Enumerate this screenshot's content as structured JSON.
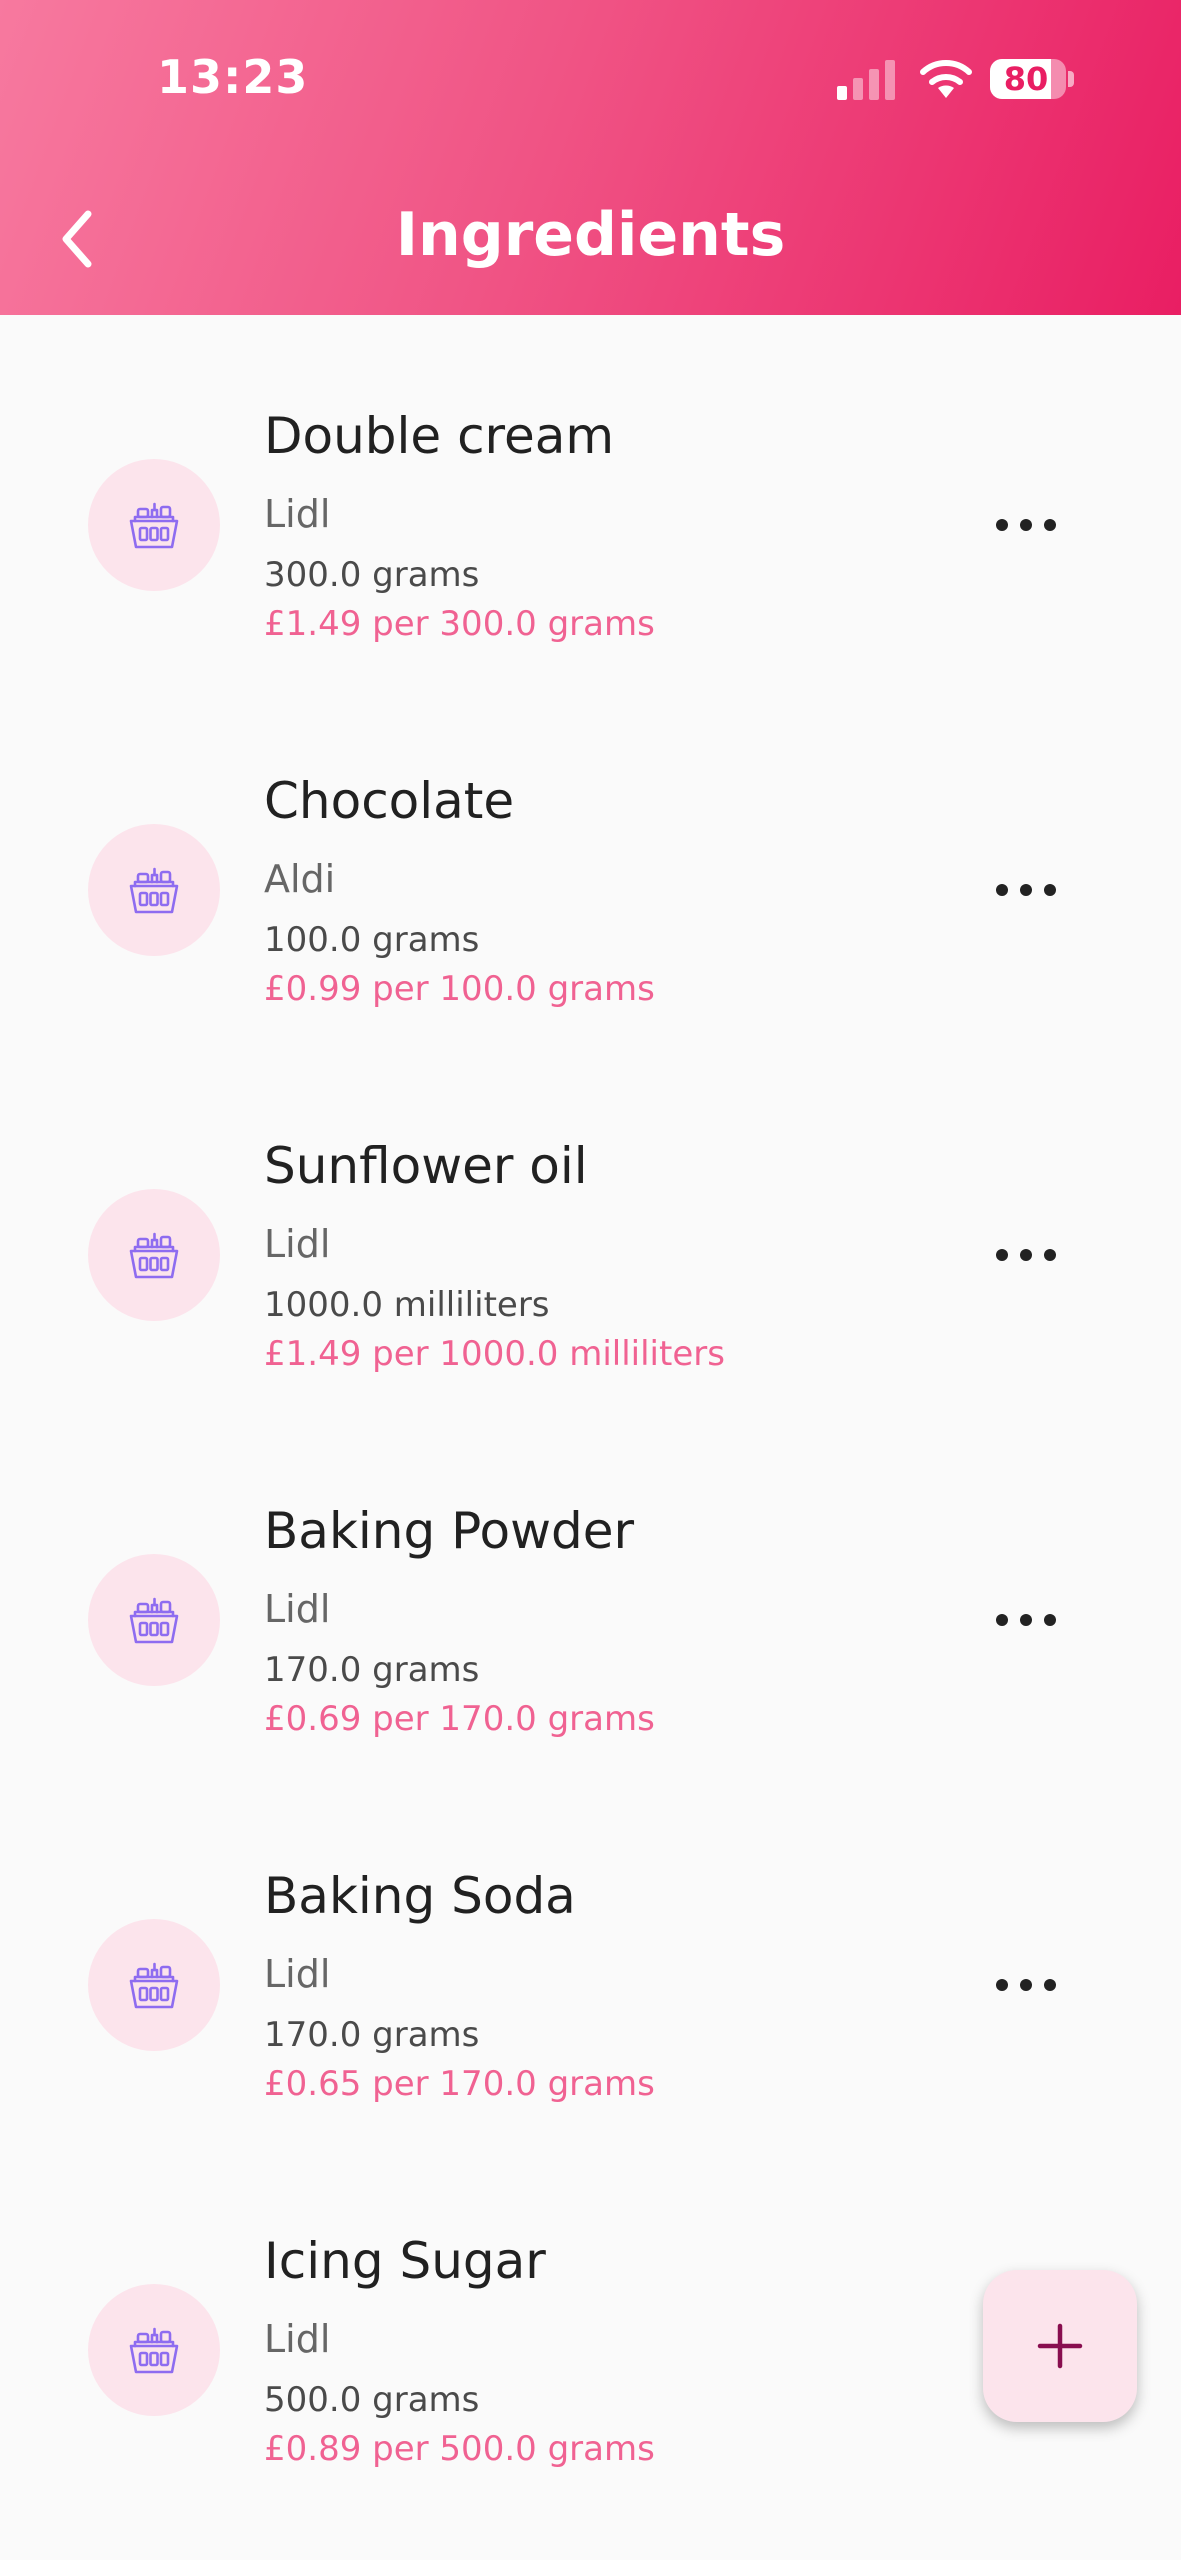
{
  "status_bar": {
    "time": "13:23",
    "battery": "80",
    "battery_level": 0.8
  },
  "header": {
    "title": "Ingredients",
    "back_icon": "chevron-left-icon"
  },
  "ingredients": [
    {
      "name": "Double cream",
      "store": "Lidl",
      "quantity": "300.0 grams",
      "price": "£1.49 per 300.0 grams"
    },
    {
      "name": "Chocolate",
      "store": "Aldi",
      "quantity": "100.0 grams",
      "price": "£0.99 per 100.0 grams"
    },
    {
      "name": "Sunflower oil",
      "store": "Lidl",
      "quantity": "1000.0 milliliters",
      "price": "£1.49 per 1000.0 milliliters"
    },
    {
      "name": "Baking Powder",
      "store": "Lidl",
      "quantity": "170.0 grams",
      "price": "£0.69 per 170.0 grams"
    },
    {
      "name": "Baking Soda",
      "store": "Lidl",
      "quantity": "170.0 grams",
      "price": "£0.65 per 170.0 grams"
    },
    {
      "name": "Icing Sugar",
      "store": "Lidl",
      "quantity": "500.0 grams",
      "price": "£0.89 per 500.0 grams"
    }
  ],
  "icons": {
    "item_icon": "grocery-basket-icon",
    "more_icon": "more-horizontal-icon",
    "fab_icon": "plus-icon"
  },
  "colors": {
    "header_start": "#f7799f",
    "header_end": "#e91e63",
    "accent": "#f06292",
    "avatar_bg": "#fce4ec",
    "icon_color": "#8e6cf0",
    "fab_icon": "#880e4f"
  }
}
